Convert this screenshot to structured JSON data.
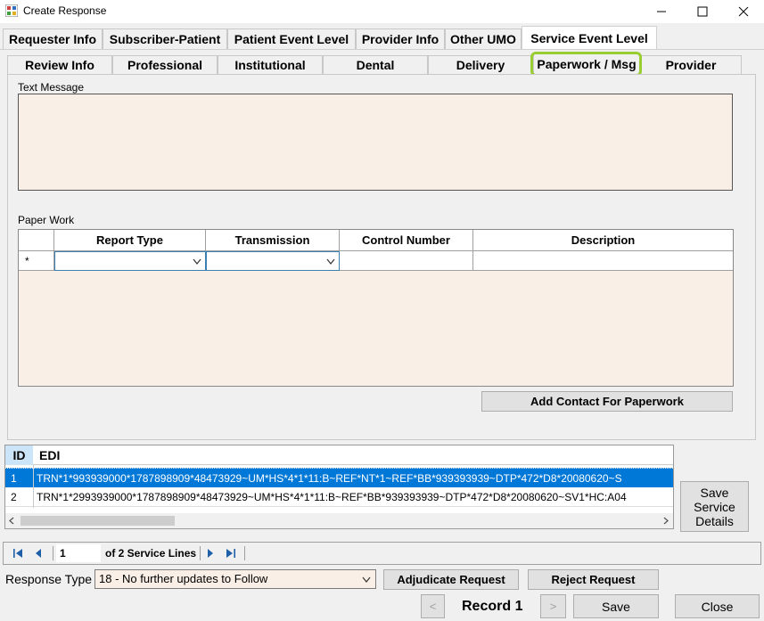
{
  "window": {
    "title": "Create Response"
  },
  "main_tabs": [
    {
      "label": "Requester Info"
    },
    {
      "label": "Subscriber-Patient"
    },
    {
      "label": "Patient Event Level"
    },
    {
      "label": "Provider Info"
    },
    {
      "label": "Other UMO"
    },
    {
      "label": "Service Event Level"
    }
  ],
  "sub_tabs": [
    {
      "label": "Review Info"
    },
    {
      "label": "Professional"
    },
    {
      "label": "Institutional"
    },
    {
      "label": "Dental"
    },
    {
      "label": "Delivery"
    },
    {
      "label": "Paperwork / Msg"
    },
    {
      "label": "Provider"
    }
  ],
  "active_main_tab": "Service Event Level",
  "active_sub_tab": "Paperwork / Msg",
  "text_message": {
    "label": "Text Message",
    "value": ""
  },
  "paperwork": {
    "label": "Paper Work",
    "columns": [
      "Report Type",
      "Transmission",
      "Control Number",
      "Description"
    ],
    "new_row_marker": "*",
    "add_contact_button": "Add Contact For Paperwork"
  },
  "edi_grid": {
    "columns": [
      "ID",
      "EDI"
    ],
    "rows": [
      {
        "id": "1",
        "edi": "TRN*1*993939000*1787898909*48473929~UM*HS*4*1*11:B~REF*NT*1~REF*BB*939393939~DTP*472*D8*20080620~S",
        "selected": true
      },
      {
        "id": "2",
        "edi": "TRN*1*2993939000*1787898909*48473929~UM*HS*4*1*11:B~REF*BB*939393939~DTP*472*D8*20080620~SV1*HC:A04",
        "selected": false
      }
    ]
  },
  "save_service_details_button": "Save\nService\nDetails",
  "navigator": {
    "position": "1",
    "of_text": "of 2 Service Lines"
  },
  "response_type": {
    "label": "Response Type",
    "value": "18 - No further updates to Follow"
  },
  "buttons": {
    "adjudicate": "Adjudicate Request",
    "reject": "Reject Request",
    "prev": "<",
    "next": ">",
    "save": "Save",
    "close": "Close"
  },
  "record_label": "Record 1",
  "colors": {
    "input_background": "#faefe6",
    "selection": "#0078d7",
    "highlight_ring": "#9acd32"
  }
}
